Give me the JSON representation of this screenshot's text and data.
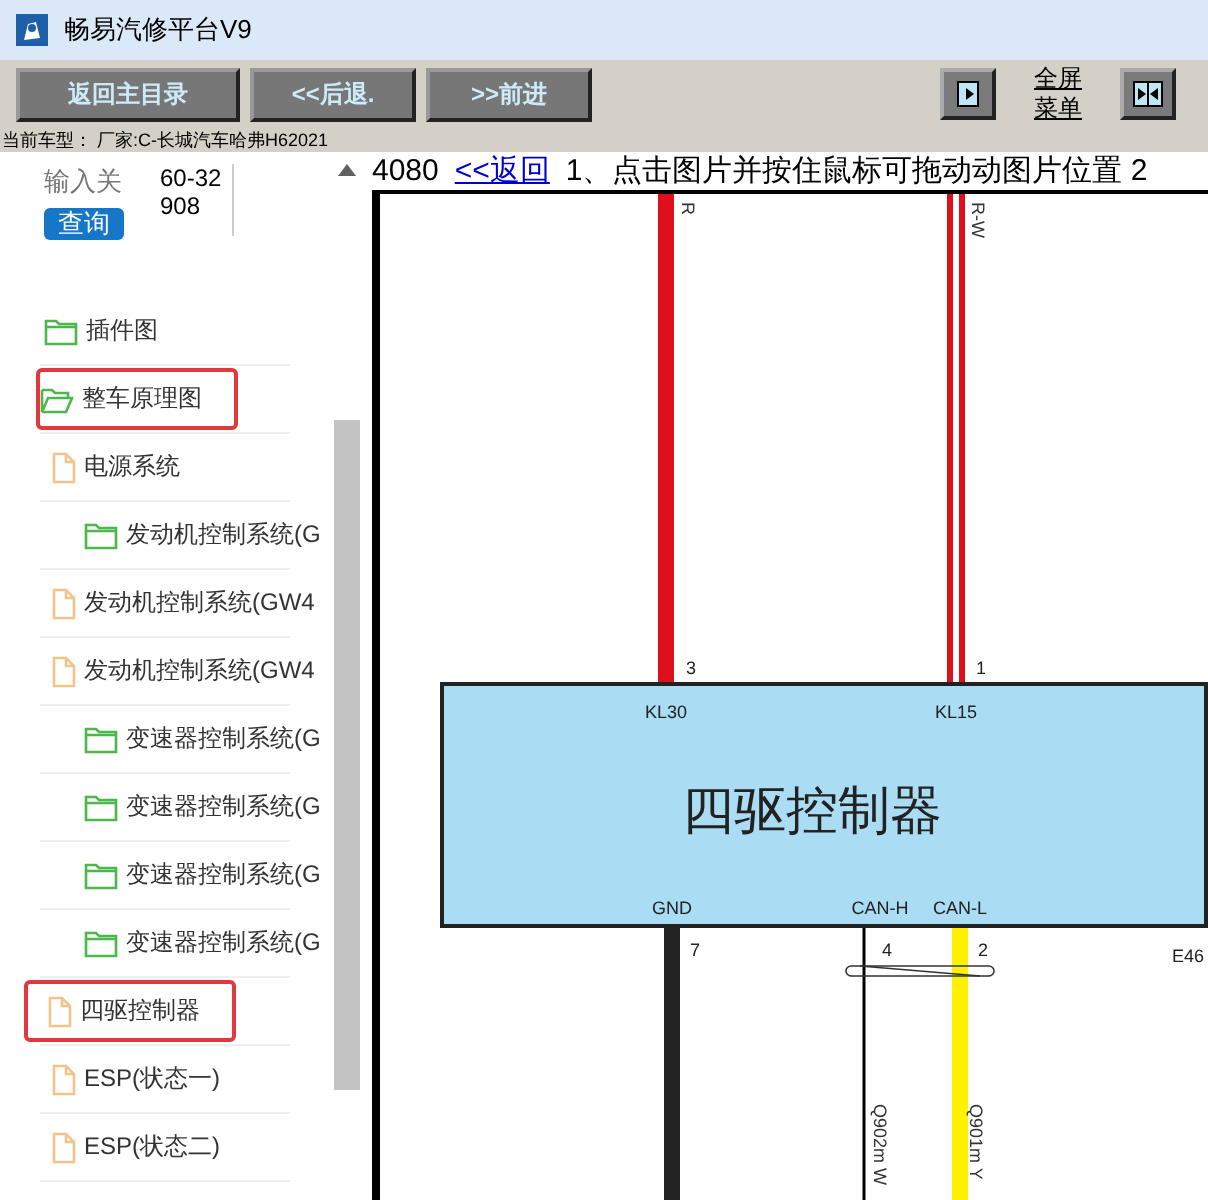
{
  "window": {
    "title": "畅易汽修平台V9"
  },
  "toolbar": {
    "buttons": [
      "返回主目录",
      "<<后退.",
      ">>前进"
    ],
    "fullscreen_label": "全屏菜单"
  },
  "vehicle_info": "当前车型： 厂家:C-长城汽车哈弗H62021",
  "search": {
    "label": "输入关",
    "value": "60-32908",
    "button": "查询"
  },
  "tree": [
    {
      "label": "插件图",
      "kind": "folder",
      "expanded": false,
      "highlighted": false
    },
    {
      "label": "整车原理图",
      "kind": "folder",
      "expanded": true,
      "highlighted": true,
      "children": [
        {
          "label": "电源系统",
          "kind": "file",
          "highlighted": false,
          "children": [
            {
              "label": "发动机控制系统(G",
              "kind": "folder",
              "expanded": false,
              "highlighted": false
            }
          ]
        },
        {
          "label": "发动机控制系统(GW4",
          "kind": "file",
          "highlighted": false
        },
        {
          "label": "发动机控制系统(GW4",
          "kind": "file",
          "highlighted": false,
          "children": [
            {
              "label": "变速器控制系统(G",
              "kind": "folder",
              "expanded": false,
              "highlighted": false
            },
            {
              "label": "变速器控制系统(G",
              "kind": "folder",
              "expanded": false,
              "highlighted": false
            },
            {
              "label": "变速器控制系统(G",
              "kind": "folder",
              "expanded": false,
              "highlighted": false
            },
            {
              "label": "变速器控制系统(G",
              "kind": "folder",
              "expanded": false,
              "highlighted": false
            }
          ]
        },
        {
          "label": "四驱控制器",
          "kind": "file",
          "highlighted": true
        },
        {
          "label": "ESP(状态一)",
          "kind": "file",
          "highlighted": false
        },
        {
          "label": "ESP(状态二)",
          "kind": "file",
          "highlighted": false
        }
      ]
    }
  ],
  "header": {
    "code": "4080",
    "back_link": "<<返回",
    "instructions": "1、点击图片并按住鼠标可拖动动图片位置 2"
  },
  "diagram": {
    "module_name": "四驱控制器",
    "connector": "E46",
    "twisted_pair": true,
    "top_pins": [
      {
        "signal": "KL30",
        "pin": "3",
        "wire": "R",
        "color": "#e0101a",
        "kind": "solid"
      },
      {
        "signal": "KL15",
        "pin": "1",
        "wire": "R-W",
        "color": "#e0101a",
        "kind": "double"
      }
    ],
    "bottom_pins": [
      {
        "signal": "GND",
        "pin": "7",
        "color": "#222222",
        "kind": "solid"
      },
      {
        "signal": "CAN-H",
        "pin": "4",
        "wire": "Q902m W",
        "color": "#000000",
        "kind": "thin"
      },
      {
        "signal": "CAN-L",
        "pin": "2",
        "wire": "Q901m Y",
        "color": "#fff200",
        "kind": "solid"
      }
    ]
  }
}
